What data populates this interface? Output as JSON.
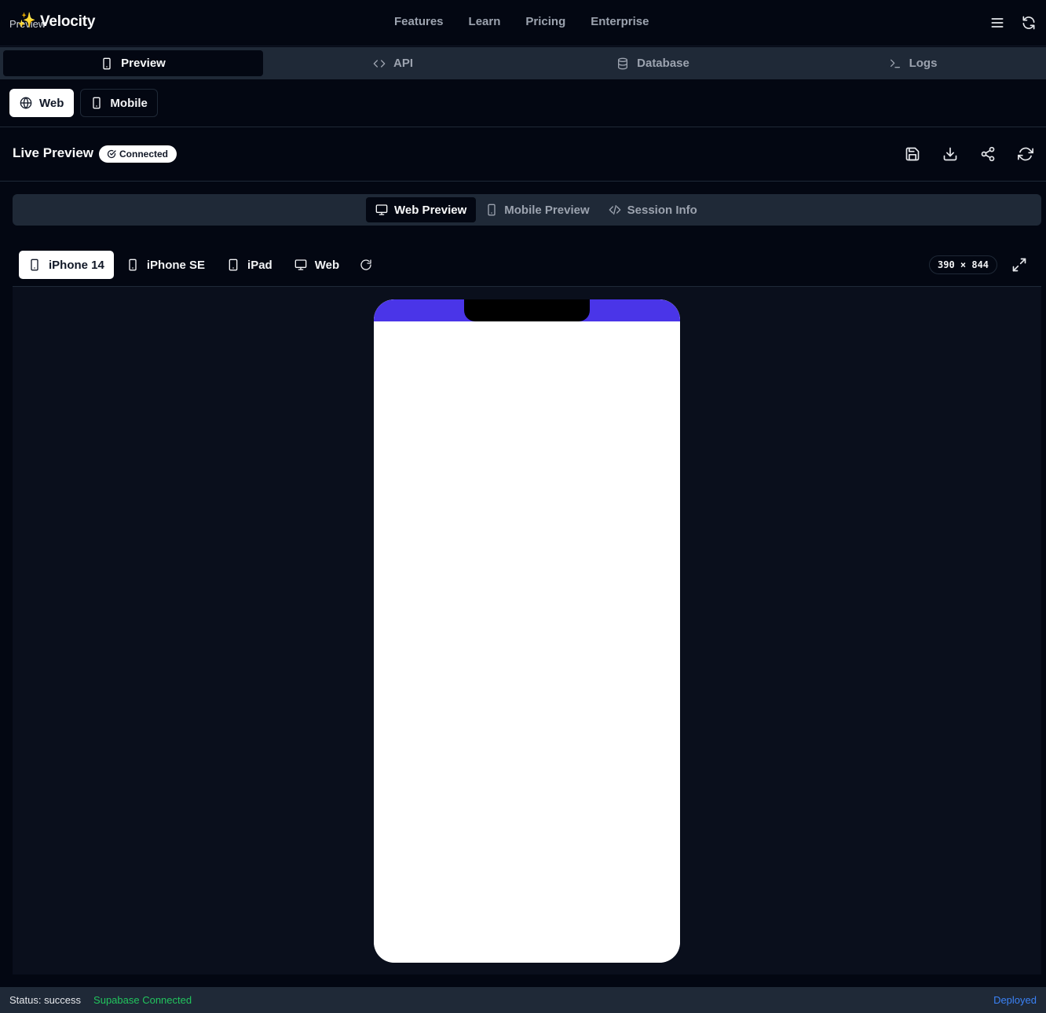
{
  "brand": {
    "ghost_text": "Preview",
    "name": "Velocity"
  },
  "nav": {
    "links": [
      "Features",
      "Learn",
      "Pricing",
      "Enterprise"
    ]
  },
  "main_tabs": [
    {
      "label": "Preview",
      "icon": "smartphone-icon",
      "active": true
    },
    {
      "label": "API",
      "icon": "code-icon",
      "active": false
    },
    {
      "label": "Database",
      "icon": "database-icon",
      "active": false
    },
    {
      "label": "Logs",
      "icon": "terminal-icon",
      "active": false
    }
  ],
  "platform": {
    "web_label": "Web",
    "mobile_label": "Mobile",
    "selected": "Web"
  },
  "live_preview": {
    "title": "Live Preview",
    "badge": "Connected",
    "actions": [
      "save-icon",
      "download-icon",
      "share-icon",
      "refresh-icon"
    ]
  },
  "mode_tabs": [
    {
      "label": "Web Preview",
      "icon": "monitor-icon",
      "active": true
    },
    {
      "label": "Mobile Preview",
      "icon": "smartphone-icon",
      "active": false
    },
    {
      "label": "Session Info",
      "icon": "code-icon",
      "active": false
    }
  ],
  "devices": [
    {
      "label": "iPhone 14",
      "icon": "smartphone-icon",
      "active": true
    },
    {
      "label": "iPhone SE",
      "icon": "smartphone-icon",
      "active": false
    },
    {
      "label": "iPad",
      "icon": "tablet-icon",
      "active": false
    },
    {
      "label": "Web",
      "icon": "monitor-icon",
      "active": false
    }
  ],
  "dimensions": "390 × 844",
  "colors": {
    "phone_status": "#4a35e8",
    "connected": "#22c55e",
    "deployed": "#3b82f6"
  },
  "status_bar": {
    "status": "Status: success",
    "database": "Supabase Connected",
    "deploy": "Deployed"
  }
}
